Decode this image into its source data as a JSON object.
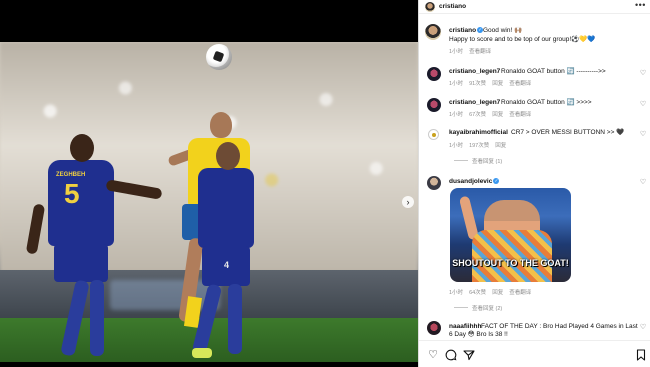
{
  "post": {
    "author": "cristiano",
    "caption_line1": "Good win! 🙌🏽",
    "caption_line2": "Happy to score and to be top of our group!⚽️💛💙",
    "time": "1小时",
    "translate": "查看翻译"
  },
  "photo": {
    "jersey_name": "ZEGHBEH",
    "jersey_number": "5",
    "front_number": "4"
  },
  "comments": [
    {
      "username": "cristiano_legen7",
      "text": "Ronaldo GOAT button 🔄 ---------->>",
      "time": "1小时",
      "likes": "91次赞",
      "reply": "回复",
      "translate": "查看翻译"
    },
    {
      "username": "cristiano_legen7",
      "text": "Ronaldo GOAT button 🔄 >>>>",
      "time": "1小时",
      "likes": "67次赞",
      "reply": "回复",
      "translate": "查看翻译"
    },
    {
      "username": "kayaibrahimofficial",
      "text": "CR7 > OVER MESSI BUTTONN >> 🖤",
      "time": "1小时",
      "likes": "197次赞",
      "reply": "回复",
      "view_replies": "查看回复 (1)"
    },
    {
      "username": "dusandjolevic",
      "gif_text": "SHOUTOUT TO THE GOAT!",
      "time": "1小时",
      "likes": "64次赞",
      "reply": "回复",
      "translate": "查看翻译",
      "view_replies": "查看回复 (2)"
    },
    {
      "username": "naaafiihhh",
      "text_line1": "FACT OF THE DAY : Bro Had Played 4 Games in Last",
      "text_line2": "6 Day 😳 Bro Is 38 !!"
    }
  ],
  "icons": {
    "more": "more-dots-icon",
    "like": "heart-icon",
    "comment": "comment-icon",
    "share": "send-icon",
    "save": "bookmark-icon",
    "next": "chevron-right-icon"
  },
  "colors": {
    "verified": "#3897f0",
    "meta_text": "#8e8e8e",
    "team_yellow": "#f2d21c",
    "team_blue": "#1f2f8f"
  }
}
